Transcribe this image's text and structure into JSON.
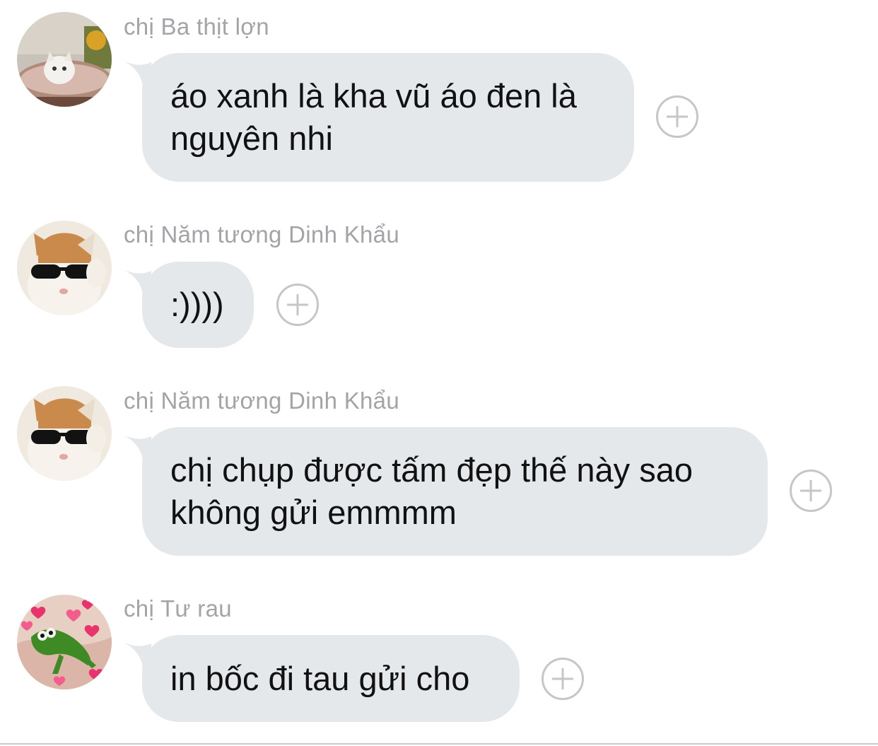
{
  "messages": [
    {
      "sender": "chị Ba thịt lợn",
      "text": "áo xanh là kha vũ áo đen là\nnguyên nhi",
      "avatar_icon": "kitten-avatar-icon",
      "react_icon": "add-reaction-icon"
    },
    {
      "sender": "chị Năm tương Dinh Khẩu",
      "text": ":))))",
      "avatar_icon": "sunglasses-cat-avatar-icon",
      "react_icon": "add-reaction-icon"
    },
    {
      "sender": "chị Năm tương Dinh Khẩu",
      "text": "chị chụp được tấm đẹp thế này sao\nkhông gửi emmmm",
      "avatar_icon": "sunglasses-cat-avatar-icon",
      "react_icon": "add-reaction-icon"
    },
    {
      "sender": "chị Tư rau",
      "text": "in bốc đi tau gửi cho",
      "avatar_icon": "frog-hearts-avatar-icon",
      "react_icon": "add-reaction-icon"
    }
  ],
  "colors": {
    "bubble_bg": "#e5e8eb",
    "sender_text": "#a3a3a8",
    "message_text": "#111111",
    "react_button": "#c6c6c9"
  }
}
